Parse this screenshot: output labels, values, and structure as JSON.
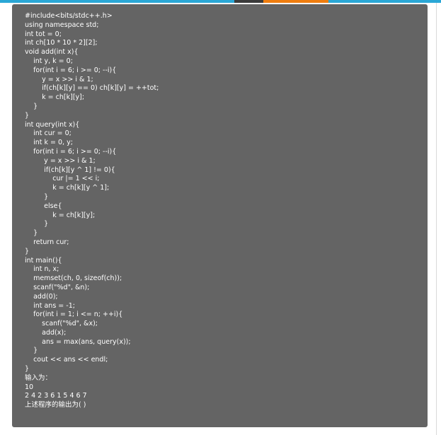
{
  "code_lines": [
    "#include<bits/stdc++.h>",
    "using namespace std;",
    "int tot = 0;",
    "int ch[10 * 10 * 2][2];",
    "void add(int x){",
    "    int y, k = 0;",
    "    for(int i = 6; i >= 0; --i){",
    "        y = x >> i & 1;",
    "        if(ch[k][y] == 0) ch[k][y] = ++tot;",
    "        k = ch[k][y];",
    "    }",
    "}",
    "int query(int x){",
    "    int cur = 0;",
    "    int k = 0, y;",
    "    for(int i = 6; i >= 0; --i){",
    "         y = x >> i & 1;",
    "         if(ch[k][y ^ 1] != 0){",
    "             cur |= 1 << i;",
    "             k = ch[k][y ^ 1];",
    "         }",
    "         else{",
    "             k = ch[k][y];",
    "         }",
    "    }",
    "    return cur;",
    "}",
    "int main(){",
    "    int n, x;",
    "    memset(ch, 0, sizeof(ch));",
    "    scanf(\"%d\", &n);",
    "    add(0);",
    "    int ans = -1;",
    "    for(int i = 1; i <= n; ++i){",
    "        scanf(\"%d\", &x);",
    "        add(x);",
    "        ans = max(ans, query(x));",
    "    }",
    "    cout << ans << endl;",
    "}"
  ],
  "question": {
    "input_label": "输入为：",
    "input_n": "10",
    "input_values": "2 4 2 3 6 1 5 4 6 7",
    "prompt": "上述程序的输出为( )"
  },
  "colors": {
    "card_background": "#646464",
    "text": "#ffffff",
    "top_strip": "#2aa7d6",
    "top_strip_accent": "#ef7d0f"
  }
}
